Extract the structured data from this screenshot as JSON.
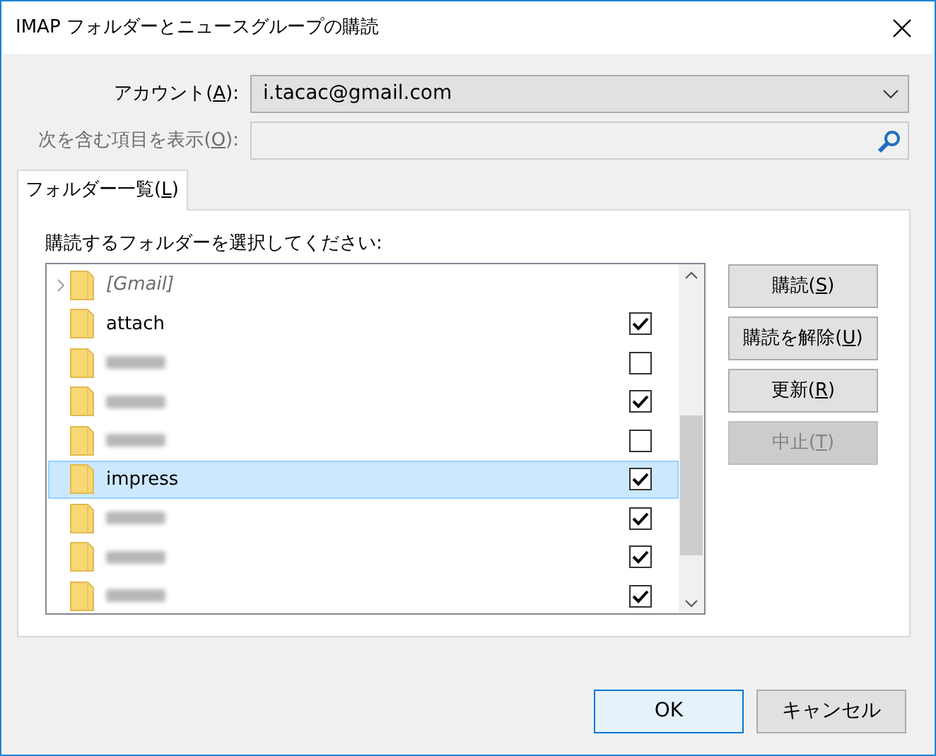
{
  "window": {
    "title": "IMAP フォルダーとニュースグループの購読"
  },
  "account": {
    "label": {
      "before": "アカウント(",
      "key": "A",
      "after": "):"
    },
    "value": "i.tacac@gmail.com"
  },
  "filter": {
    "label": {
      "before": "次を含む項目を表示(",
      "key": "O",
      "after": "):"
    },
    "disabled": true
  },
  "tabs": [
    {
      "label": {
        "before": "フォルダー一覧(",
        "key": "L",
        "after": ")"
      },
      "selected": true
    }
  ],
  "prompt": "購読するフォルダーを選択してください:",
  "folders": [
    {
      "kind": "named",
      "name": "[Gmail]",
      "expandable": true,
      "italic": true,
      "selected": false
    },
    {
      "kind": "named",
      "name": "attach",
      "expandable": false,
      "italic": false,
      "checked": true,
      "selected": false
    },
    {
      "kind": "redacted",
      "expandable": false,
      "checked": false,
      "selected": false
    },
    {
      "kind": "redacted",
      "expandable": false,
      "checked": true,
      "selected": false
    },
    {
      "kind": "redacted",
      "expandable": false,
      "checked": false,
      "selected": false
    },
    {
      "kind": "named",
      "name": "impress",
      "expandable": false,
      "italic": false,
      "checked": true,
      "selected": true
    },
    {
      "kind": "redacted",
      "expandable": false,
      "checked": true,
      "selected": false
    },
    {
      "kind": "redacted",
      "expandable": false,
      "checked": true,
      "selected": false
    },
    {
      "kind": "redacted",
      "expandable": false,
      "checked": true,
      "selected": false
    }
  ],
  "side_buttons": [
    {
      "label": {
        "before": "購読(",
        "key": "S",
        "after": ")"
      },
      "disabled": false
    },
    {
      "label": {
        "before": "購読を解除(",
        "key": "U",
        "after": ")"
      },
      "disabled": false
    },
    {
      "label": {
        "before": "更新(",
        "key": "R",
        "after": ")"
      },
      "disabled": false
    },
    {
      "label": {
        "before": "中止(",
        "key": "T",
        "after": ")"
      },
      "disabled": true
    }
  ],
  "footer_buttons": [
    {
      "label": "OK",
      "default": true
    },
    {
      "label": "キャンセル",
      "default": false
    }
  ]
}
